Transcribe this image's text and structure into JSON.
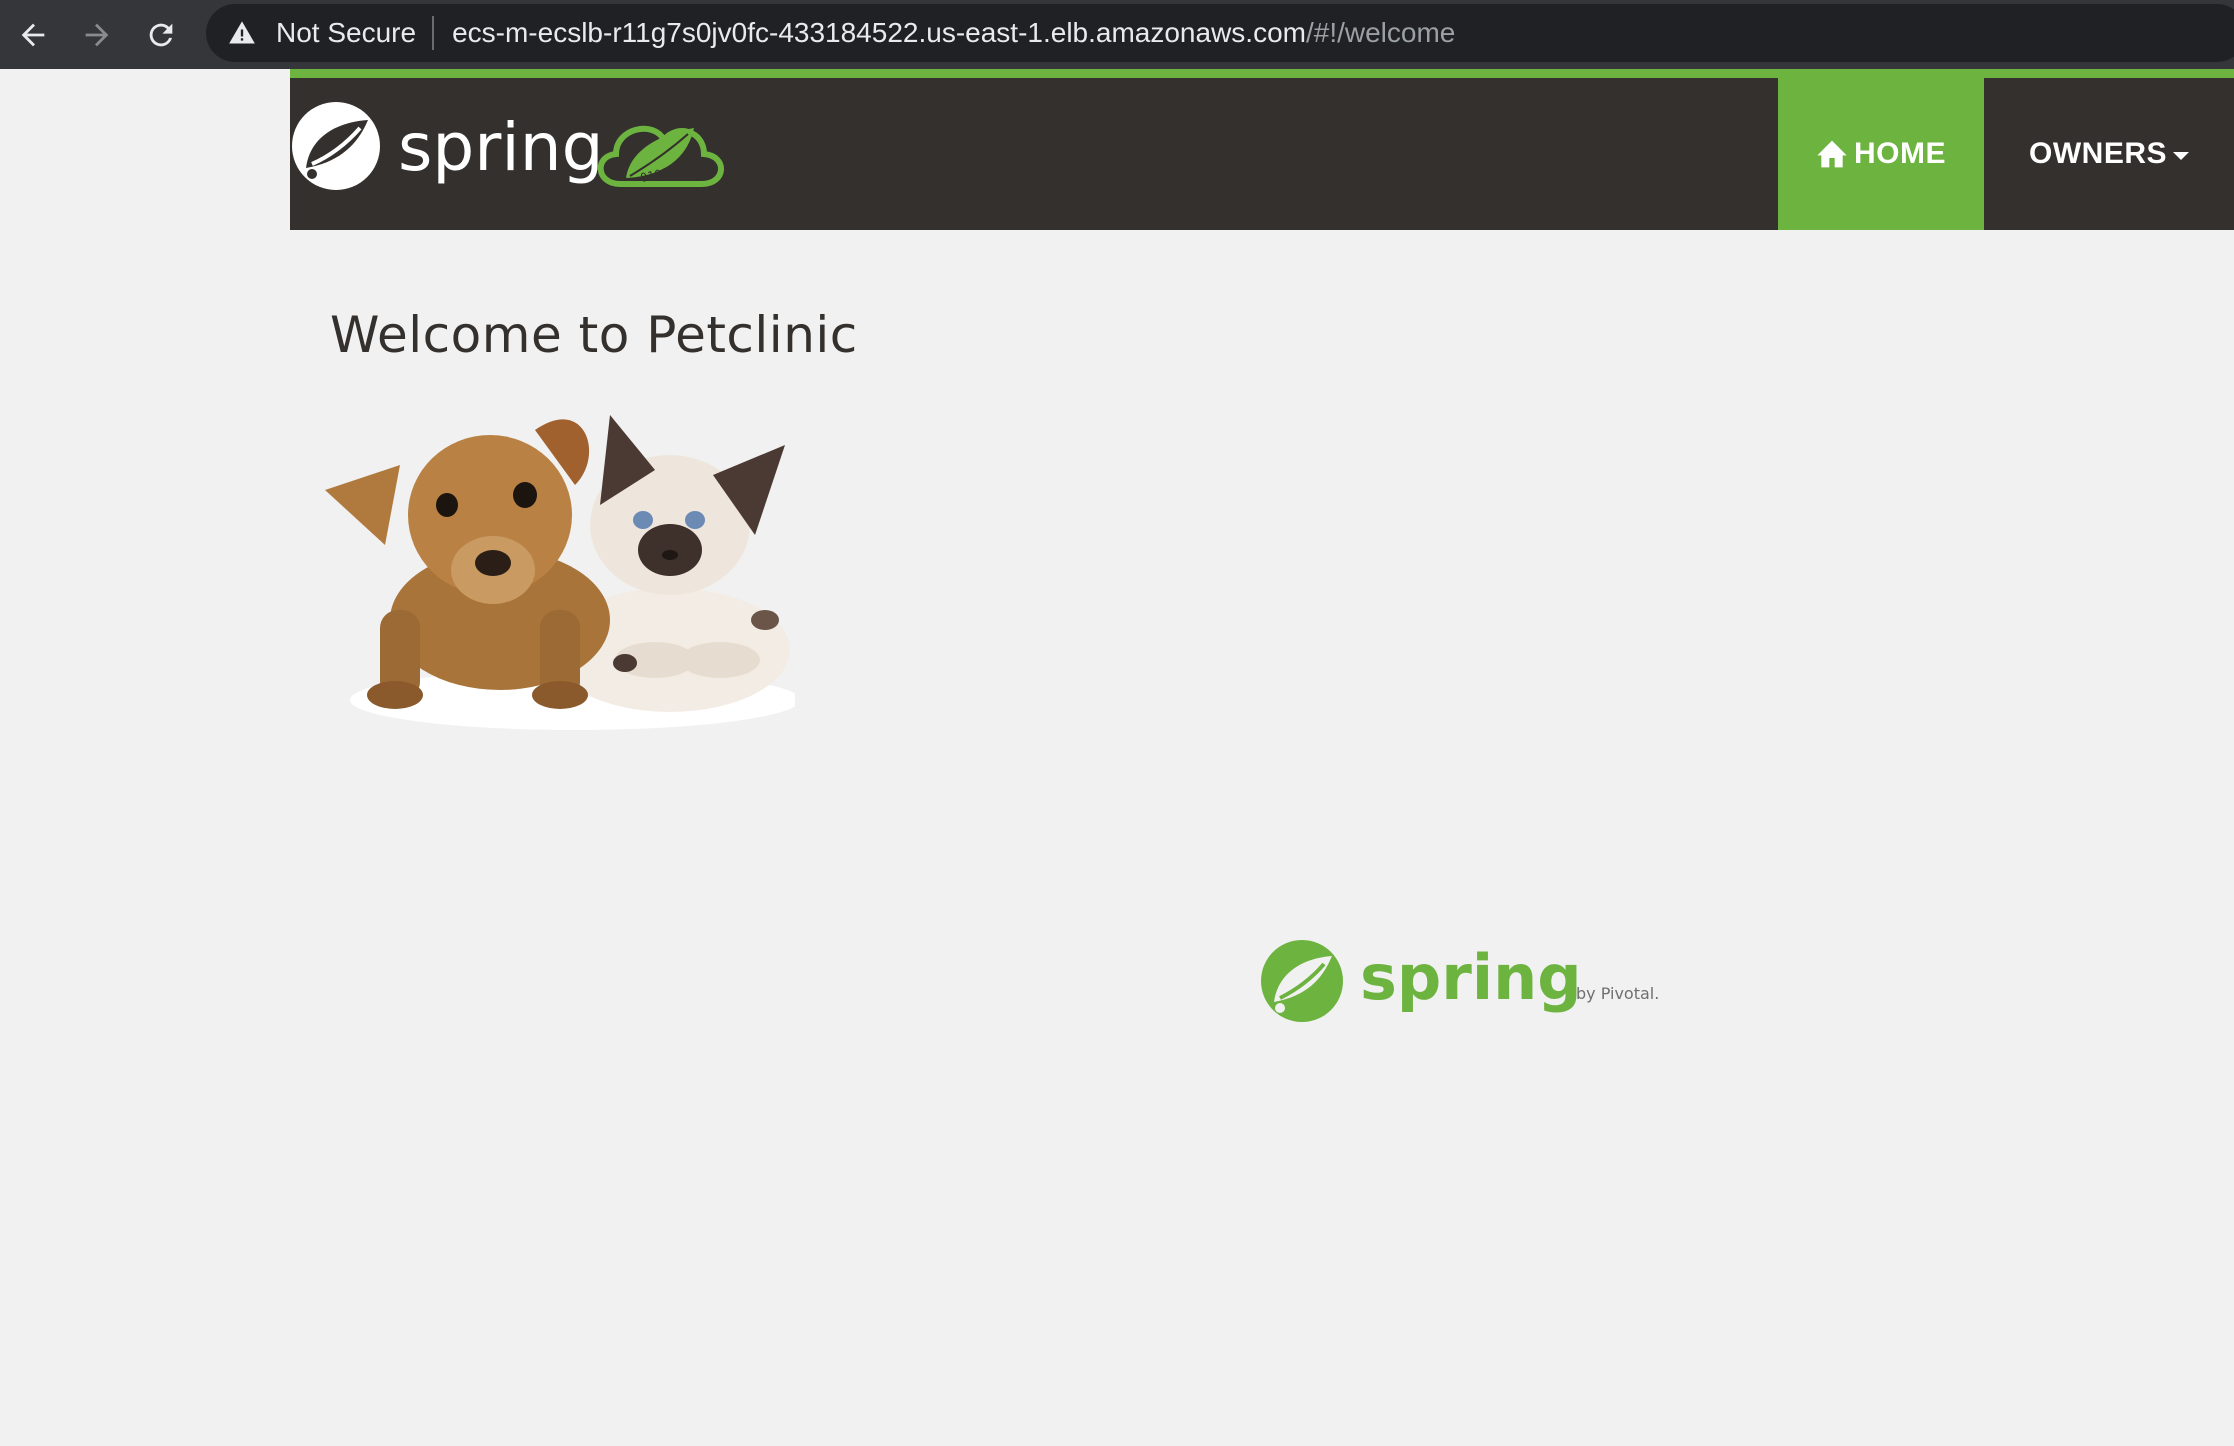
{
  "browser": {
    "security_label": "Not Secure",
    "url_host": "ecs-m-ecslb-r11g7s0jv0fc-433184522.us-east-1.elb.amazonaws.com",
    "url_path": "/#!/welcome"
  },
  "navbar": {
    "brand_text": "spring",
    "badge_text": "01010",
    "items": [
      {
        "label": "HOME",
        "icon": "home-icon",
        "active": true
      },
      {
        "label": "OWNERS",
        "icon": "caret-down-icon",
        "active": false
      }
    ]
  },
  "main": {
    "title": "Welcome to Petclinic"
  },
  "footer": {
    "logo_text": "spring",
    "logo_sub": "by Pivotal."
  },
  "colors": {
    "brand_green": "#6db33f",
    "navbar_bg": "#34302d",
    "page_bg": "#f1f1f1",
    "browser_chrome": "#35363a"
  }
}
